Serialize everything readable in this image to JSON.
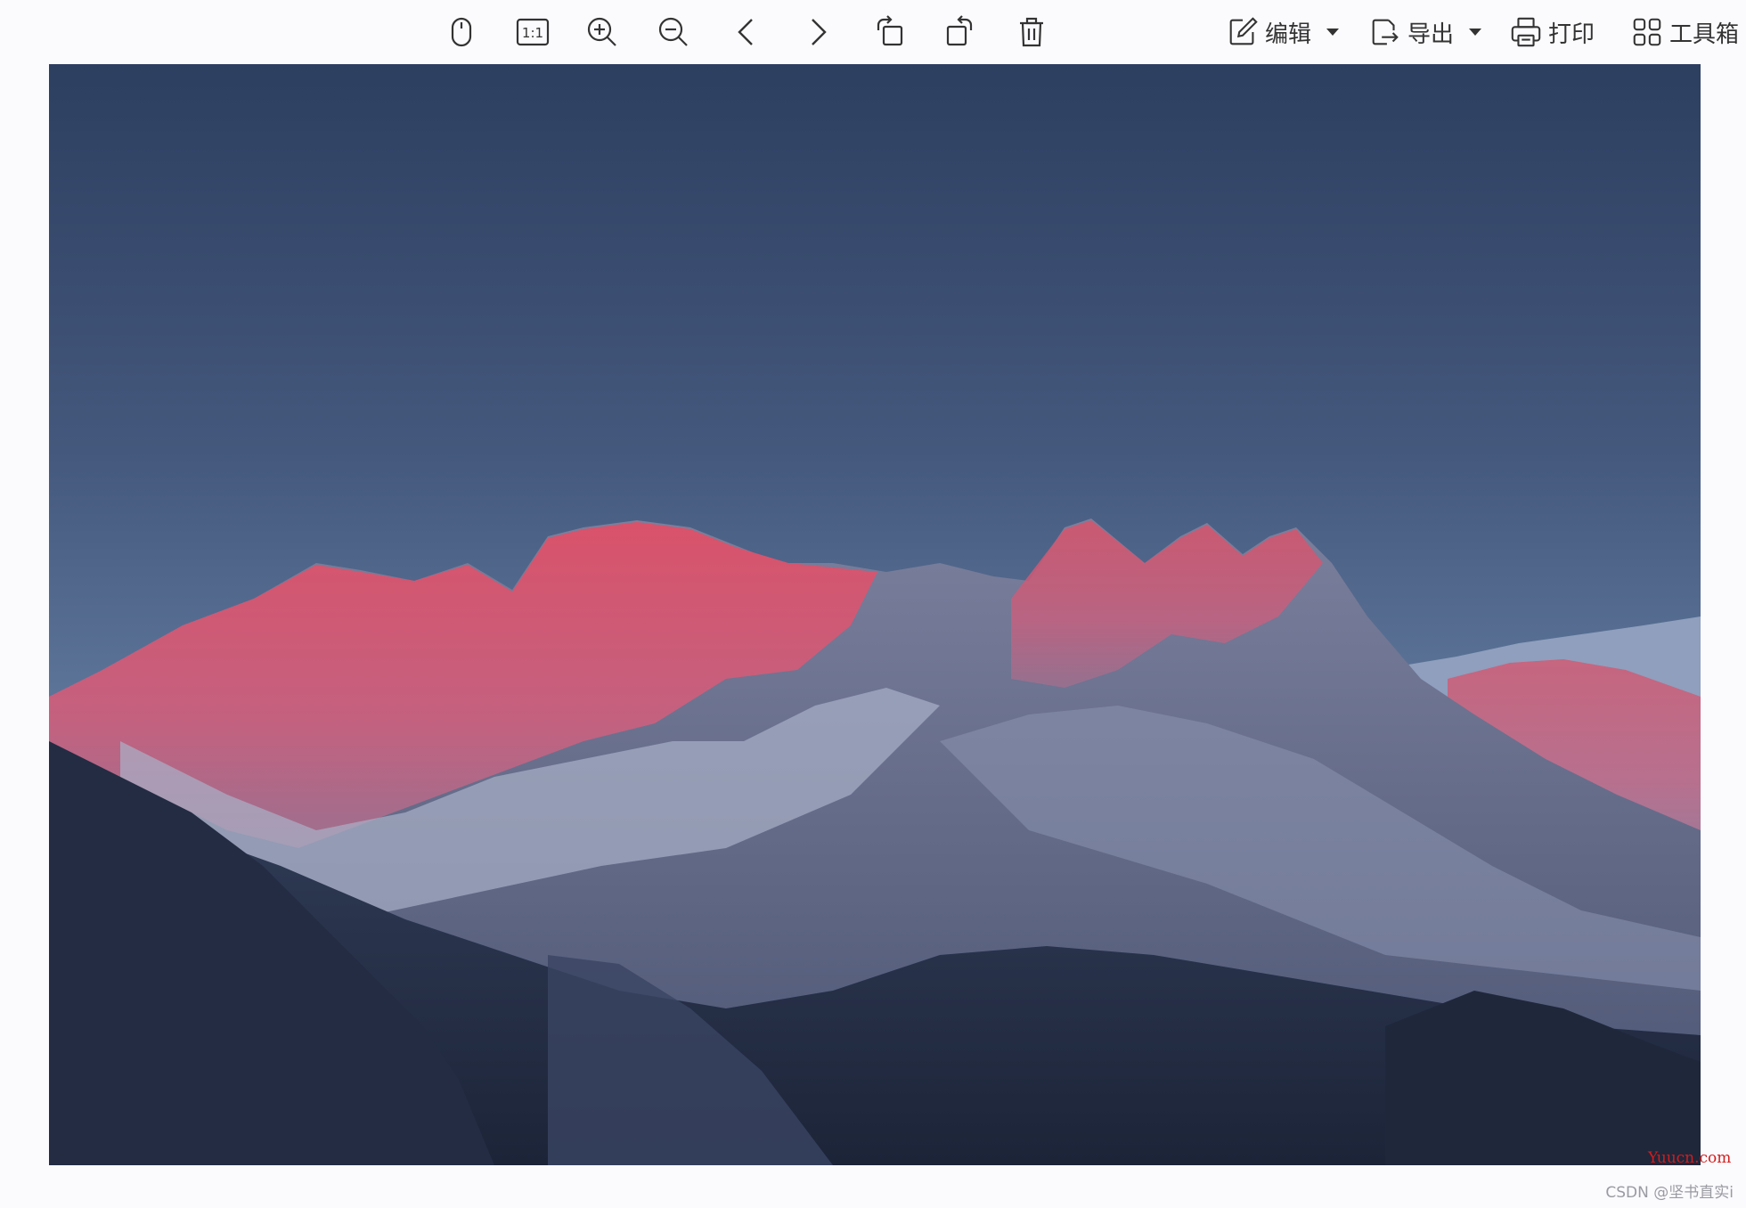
{
  "toolbar": {
    "icons": [
      {
        "name": "mouse-icon"
      },
      {
        "name": "actual-size-icon",
        "text": "1:1"
      },
      {
        "name": "zoom-in-icon"
      },
      {
        "name": "zoom-out-icon"
      },
      {
        "name": "previous-icon"
      },
      {
        "name": "next-icon"
      },
      {
        "name": "rotate-left-icon"
      },
      {
        "name": "rotate-right-icon"
      },
      {
        "name": "delete-icon"
      }
    ],
    "edit_label": "编辑",
    "export_label": "导出",
    "print_label": "打印",
    "toolbox_label": "工具箱"
  },
  "image": {
    "subject": "mountain-range-at-dusk"
  },
  "watermarks": {
    "site": "Yuucn.com",
    "author": "CSDN @坚书直实i"
  },
  "colors": {
    "background": "#fbfbfe",
    "sky_top": "#2d3f60",
    "sky_bottom": "#6a84a8",
    "alpenglow": "#d9526a",
    "forest": "#27324a",
    "watermark_red": "#d41c1c"
  }
}
